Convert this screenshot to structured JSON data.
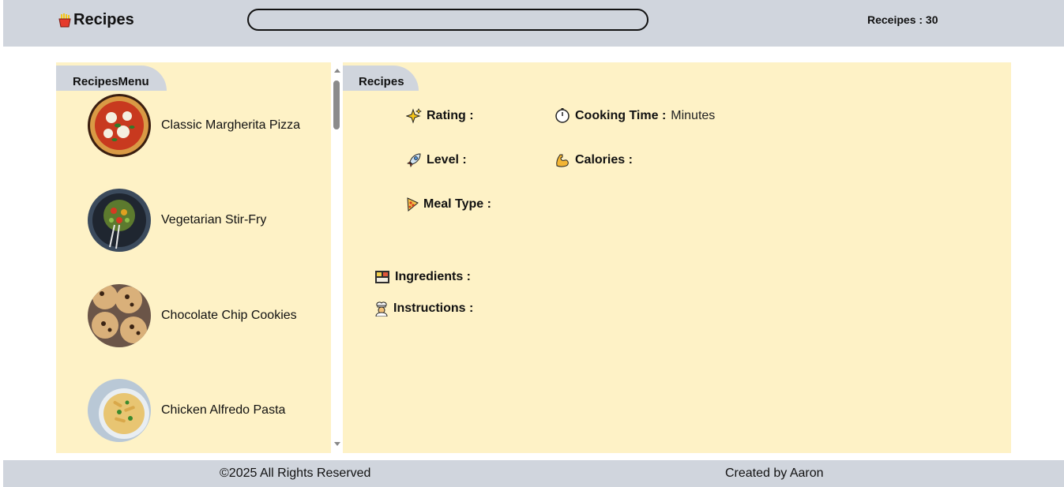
{
  "header": {
    "title": "Recipes",
    "icon": "fries-icon",
    "search_placeholder": "",
    "count_text": "Receipes : 30"
  },
  "menu": {
    "title": "RecipesMenu",
    "items": [
      {
        "label": "Classic Margherita Pizza",
        "image": "pizza"
      },
      {
        "label": "Vegetarian Stir-Fry",
        "image": "stir-fry"
      },
      {
        "label": "Chocolate Chip Cookies",
        "image": "cookies"
      },
      {
        "label": "Chicken Alfredo Pasta",
        "image": "pasta"
      }
    ]
  },
  "detail": {
    "title": "Recipes",
    "rating_label": "Rating :",
    "cooking_time_label": "Cooking Time :",
    "cooking_time_unit": "Minutes",
    "level_label": "Level :",
    "calories_label": "Calories :",
    "meal_type_label": "Meal Type :",
    "ingredients_label": "Ingredients :",
    "instructions_label": "Instructions :"
  },
  "footer": {
    "copyright": "©2025 All Rights Reserved",
    "credit": "Created by Aaron"
  },
  "colors": {
    "header_bg": "#d0d5dd",
    "panel_bg": "#fef2c6",
    "text": "#111111"
  }
}
